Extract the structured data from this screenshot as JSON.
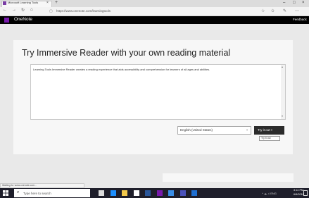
{
  "browser": {
    "tab_title": "Microsoft Learning Tools",
    "tab_close": "×",
    "new_tab": "+",
    "url": "https://www.onenote.com/learningtools",
    "window_controls": [
      "–",
      "□",
      "×"
    ],
    "nav_icons": [
      "arrow-left-icon",
      "arrow-right-icon",
      "refresh-icon",
      "home-icon"
    ],
    "nav_glyphs": [
      "←",
      "→",
      "↻",
      "⌂"
    ],
    "toolbar_glyphs": [
      "☆",
      "✩",
      "✎",
      "⋯"
    ]
  },
  "app": {
    "name": "OneNote",
    "feedback": "Feedback",
    "accent": "#7719aa"
  },
  "main": {
    "heading": "Try Immersive Reader with your own reading material",
    "body_text": "Learning Tools Immersive Reader creates a reading experience that aids accessibility and comprehension for learners of all ages and abilities.",
    "language": "English (United States)",
    "try_button": "Try it out   >",
    "tooltip": "Try it out"
  },
  "status_bar": {
    "text": "Waiting for www.onenote.com..."
  },
  "taskbar": {
    "search_placeholder": "Type here to search",
    "tray_text": "^ ☁ ♫ ENG",
    "time": "3:14 PM",
    "date": "6/6/2018",
    "app_icons": [
      {
        "name": "task-view-icon",
        "color": "#dddddd"
      },
      {
        "name": "edge-icon",
        "color": "#1e90ff"
      },
      {
        "name": "file-explorer-icon",
        "color": "#f2c94c"
      },
      {
        "name": "store-icon",
        "color": "#ffffff"
      },
      {
        "name": "word-icon",
        "color": "#2b579a"
      },
      {
        "name": "onenote-icon",
        "color": "#7719aa"
      },
      {
        "name": "mail-icon",
        "color": "#3a8ee6"
      },
      {
        "name": "teams-icon",
        "color": "#4b53bc"
      },
      {
        "name": "photos-icon",
        "color": "#1f6fd1"
      }
    ]
  }
}
